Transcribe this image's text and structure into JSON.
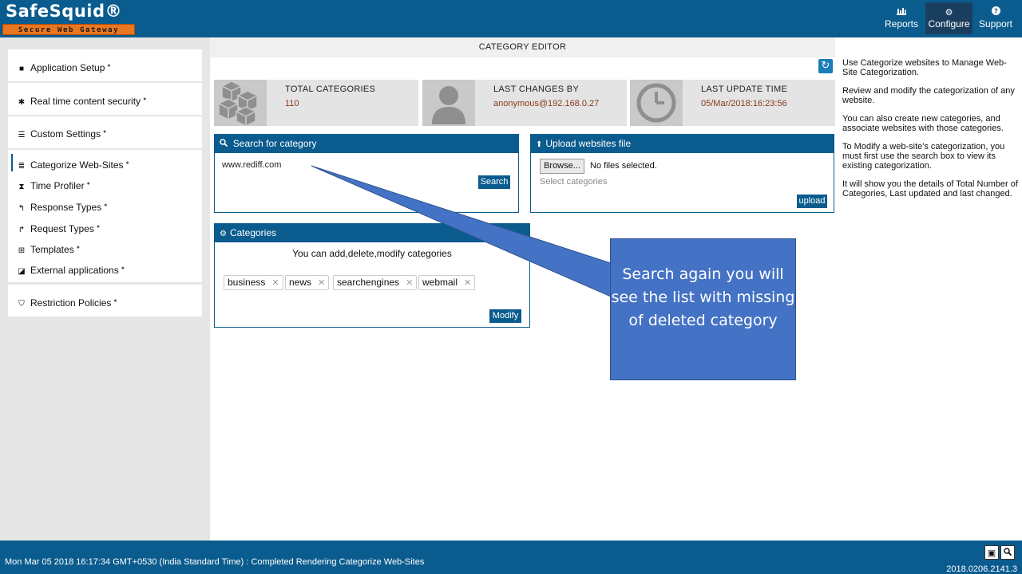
{
  "header": {
    "logo_text": "SafeSquid®",
    "logo_tagline": "Secure Web Gateway",
    "nav": [
      {
        "label": "Reports",
        "icon": "chart-icon"
      },
      {
        "label": "Configure",
        "icon": "gears-icon"
      },
      {
        "label": "Support",
        "icon": "question-icon"
      }
    ]
  },
  "sidebar": {
    "groups": [
      {
        "label": "Application Setup"
      },
      {
        "label": "Real time content security"
      },
      {
        "label": "Custom Settings"
      }
    ],
    "items": [
      {
        "label": "Categorize Web-Sites",
        "active": true
      },
      {
        "label": "Time Profiler"
      },
      {
        "label": "Response Types"
      },
      {
        "label": "Request Types"
      },
      {
        "label": "Templates"
      },
      {
        "label": "External applications"
      }
    ],
    "restriction": {
      "label": "Restriction Policies"
    }
  },
  "main": {
    "title": "CATEGORY EDITOR",
    "stats": [
      {
        "label": "TOTAL CATEGORIES",
        "value": "110",
        "icon": "cubes-icon"
      },
      {
        "label": "LAST CHANGES BY",
        "value": "anonymous@192.168.0.27",
        "icon": "user-icon"
      },
      {
        "label": "LAST UPDATE TIME",
        "value": "05/Mar/2018:16:23:56",
        "icon": "clock-icon"
      }
    ],
    "search_panel": {
      "title": "Search for category",
      "input_value": "www.rediff.com",
      "button": "Search"
    },
    "upload_panel": {
      "title": "Upload websites file",
      "browse": "Browse...",
      "no_file": "No files selected.",
      "select_placeholder": "Select categories",
      "button": "upload"
    },
    "categories_panel": {
      "title": "Categories",
      "help": "You can add,delete,modify categories",
      "tags": [
        "business",
        "news",
        "searchengines",
        "webmail"
      ],
      "button": "Modify"
    }
  },
  "callout": {
    "text": "Search again you will see the list with missing of deleted category",
    "color": "#4472c4"
  },
  "help": {
    "paragraphs": [
      "Use Categorize websites to Manage Web-Site Categorization.",
      "Review and modify the categorization of any website.",
      "You can also create new categories, and associate websites with those categories.",
      "To Modify a web-site's categorization, you must first use the search box to view its existing categorization.",
      "It will show you the details of Total Number of Categories, Last updated and last changed."
    ]
  },
  "footer": {
    "status": "Mon Mar 05 2018 16:17:34 GMT+0530 (India Standard Time) : Completed Rendering Categorize Web-Sites",
    "version": "2018.0206.2141.3"
  },
  "colors": {
    "primary": "#0b5c8e",
    "accent": "#e87722",
    "value_text": "#8a3a1a"
  }
}
